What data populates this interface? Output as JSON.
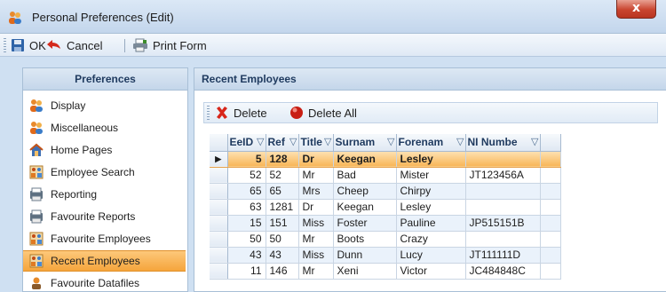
{
  "window": {
    "title": "Personal Preferences (Edit)",
    "close_label": "x"
  },
  "toolbar": {
    "ok_label": "OK",
    "cancel_label": "Cancel",
    "print_label": "Print Form"
  },
  "left_panel": {
    "header": "Preferences",
    "items": [
      {
        "label": "Display",
        "icon": "people-icon"
      },
      {
        "label": "Miscellaneous",
        "icon": "people-icon"
      },
      {
        "label": "Home Pages",
        "icon": "house-icon"
      },
      {
        "label": "Employee Search",
        "icon": "people-grid-icon"
      },
      {
        "label": "Reporting",
        "icon": "report-icon"
      },
      {
        "label": "Favourite Reports",
        "icon": "report-icon"
      },
      {
        "label": "Favourite Employees",
        "icon": "people-grid-icon"
      },
      {
        "label": "Recent Employees",
        "icon": "people-grid-icon",
        "selected": true
      },
      {
        "label": "Favourite Datafiles",
        "icon": "datafile-icon"
      }
    ]
  },
  "right_panel": {
    "header": "Recent Employees",
    "delete_label": "Delete",
    "delete_all_label": "Delete All"
  },
  "grid": {
    "columns": [
      "EeID",
      "Ref",
      "Title",
      "Surnam",
      "Forenam",
      "NI Numbe"
    ],
    "rows": [
      {
        "eeid": "5",
        "ref": "128",
        "title": "Dr",
        "surname": "Keegan",
        "forename": "Lesley",
        "ni": "",
        "current": true
      },
      {
        "eeid": "52",
        "ref": "52",
        "title": "Mr",
        "surname": "Bad",
        "forename": "Mister",
        "ni": "JT123456A"
      },
      {
        "eeid": "65",
        "ref": "65",
        "title": "Mrs",
        "surname": "Cheep",
        "forename": "Chirpy",
        "ni": ""
      },
      {
        "eeid": "63",
        "ref": "1281",
        "title": "Dr",
        "surname": "Keegan",
        "forename": "Lesley",
        "ni": ""
      },
      {
        "eeid": "15",
        "ref": "151",
        "title": "Miss",
        "surname": "Foster",
        "forename": "Pauline",
        "ni": "JP515151B"
      },
      {
        "eeid": "50",
        "ref": "50",
        "title": "Mr",
        "surname": "Boots",
        "forename": "Crazy",
        "ni": ""
      },
      {
        "eeid": "43",
        "ref": "43",
        "title": "Miss",
        "surname": "Dunn",
        "forename": "Lucy",
        "ni": "JT111111D"
      },
      {
        "eeid": "11",
        "ref": "146",
        "title": "Mr",
        "surname": "Xeni",
        "forename": "Victor",
        "ni": "JC484848C"
      }
    ]
  }
}
